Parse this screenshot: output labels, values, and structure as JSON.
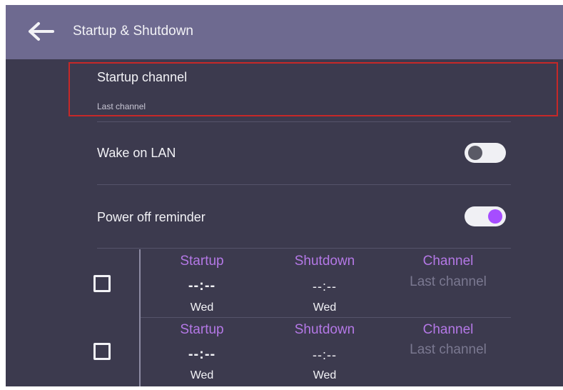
{
  "header": {
    "title": "Startup & Shutdown",
    "back_icon": "arrow-left-icon"
  },
  "startup_channel": {
    "label": "Startup channel",
    "value": "Last channel"
  },
  "wake_on_lan": {
    "label": "Wake on LAN",
    "enabled": false
  },
  "power_off_reminder": {
    "label": "Power off reminder",
    "enabled": true
  },
  "schedules": [
    {
      "checked": false,
      "startup_header": "Startup",
      "startup_time": "--:--",
      "startup_day": "Wed",
      "shutdown_header": "Shutdown",
      "shutdown_time": "--:--",
      "shutdown_day": "Wed",
      "channel_header": "Channel",
      "channel_value": "Last channel"
    },
    {
      "checked": false,
      "startup_header": "Startup",
      "startup_time": "--:--",
      "startup_day": "Wed",
      "shutdown_header": "Shutdown",
      "shutdown_time": "--:--",
      "shutdown_day": "Wed",
      "channel_header": "Channel",
      "channel_value": "Last channel"
    }
  ],
  "colors": {
    "background": "#3c3a4e",
    "header": "#6e6a90",
    "accent": "#b478e6",
    "highlight_border": "#c62828"
  }
}
